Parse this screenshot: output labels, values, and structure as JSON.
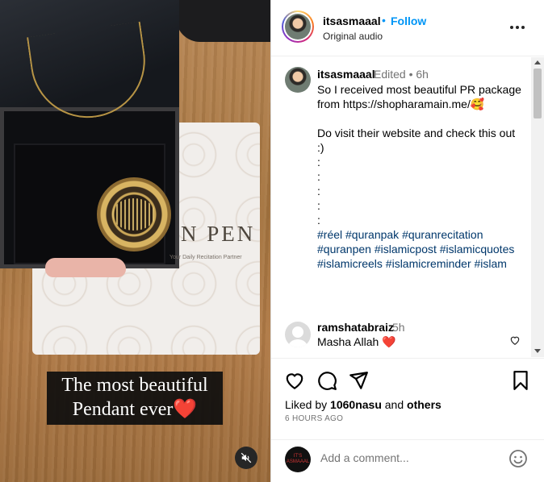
{
  "post": {
    "username": "itsasmaaal",
    "follow_label": "Follow",
    "follow_dot": "•",
    "audio": "Original audio"
  },
  "media": {
    "caption_line1": "The most beautiful",
    "caption_line2": "Pendant ever",
    "caption_emoji": "❤️",
    "card_text": "N PEN",
    "card_tagline": "Your Daily Recitation Partner"
  },
  "caption_comment": {
    "username": "itsasmaaal",
    "meta": "Edited • 6h",
    "text": "So I received most beautiful PR package from https://shopharamain.me/🥰\n\nDo visit their website and check this out :)\n:\n:\n:\n:\n:",
    "hashtags": "#réel #quranpak #quranrecitation #quranpen #islamicpost #islamicquotes #islamicreels #islamicreminder #islam"
  },
  "comment": {
    "username": "ramshatabraiz",
    "time": "5h",
    "text": "Masha Allah ❤️"
  },
  "engagement": {
    "liked_prefix": "Liked by ",
    "liked_user": "1060nasu",
    "liked_mid": " and ",
    "liked_others": "others",
    "timestamp": "6 HOURS AGO"
  },
  "add_comment": {
    "placeholder": "Add a comment...",
    "avatar_text": "IT'S ASMAAAL"
  },
  "icons": {
    "like": "heart-icon",
    "comment": "comment-icon",
    "share": "share-icon",
    "save": "bookmark-icon",
    "more": "more-options-icon",
    "mute": "muted-speaker-icon",
    "emoji": "emoji-icon"
  },
  "colors": {
    "accent": "#0095f6",
    "hashtag": "#00376b",
    "muted_text": "#737373",
    "heart_red": "#e0245e"
  }
}
